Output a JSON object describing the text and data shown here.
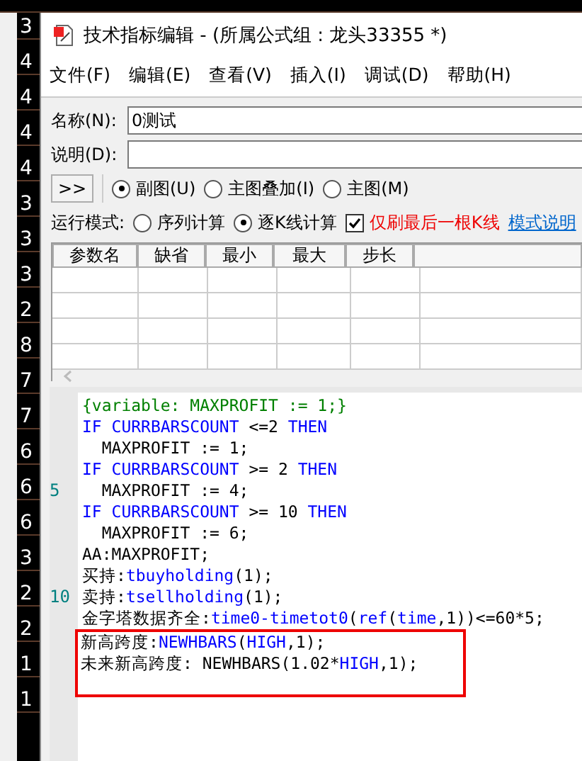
{
  "background": {
    "side_values": [
      "3",
      "4",
      "4",
      "4",
      "4",
      "3",
      "3",
      "3",
      "2",
      "8",
      "7",
      "7",
      "6",
      "6",
      "6",
      "3",
      "2",
      "2",
      "1",
      "1"
    ]
  },
  "window": {
    "title": "技术指标编辑 - (所属公式组 : 龙头33355 *)"
  },
  "menu": [
    "文件(F)",
    "编辑(E)",
    "查看(V)",
    "插入(I)",
    "调试(D)",
    "帮助(H)"
  ],
  "name_field": {
    "label": "名称(N):",
    "value": "0测试"
  },
  "description_field": {
    "label": "说明(D):"
  },
  "expand_button": ">>",
  "chart_type": [
    {
      "label": "副图(U)",
      "selected": true
    },
    {
      "label": "主图叠加(I)",
      "selected": false
    },
    {
      "label": "主图(M)",
      "selected": false
    }
  ],
  "run_mode": {
    "label": "运行模式:",
    "options": [
      {
        "label": "序列计算",
        "selected": false
      },
      {
        "label": "逐K线计算",
        "selected": true
      }
    ],
    "refresh_last": {
      "label": "仅刷最后一根K线",
      "checked": true
    },
    "help_link": "模式说明"
  },
  "params_table": {
    "columns": [
      "参数名",
      "缺省",
      "最小",
      "最大",
      "步长"
    ]
  },
  "code": {
    "lines": [
      {
        "segments": [
          {
            "kind": "comment",
            "text": "{variable: MAXPROFIT := 1;}"
          }
        ]
      },
      {
        "segments": [
          {
            "kind": "keyword",
            "text": "IF CURRBARSCOUNT"
          },
          {
            "kind": "plain",
            "text": " <=2 "
          },
          {
            "kind": "keyword",
            "text": "THEN"
          }
        ]
      },
      {
        "segments": [
          {
            "kind": "plain",
            "text": "  MAXPROFIT := 1;"
          }
        ]
      },
      {
        "segments": [
          {
            "kind": "keyword",
            "text": "IF CURRBARSCOUNT"
          },
          {
            "kind": "plain",
            "text": " >= 2 "
          },
          {
            "kind": "keyword",
            "text": "THEN"
          }
        ]
      },
      {
        "line_number": "5",
        "segments": [
          {
            "kind": "plain",
            "text": "  MAXPROFIT := 4;"
          }
        ]
      },
      {
        "segments": [
          {
            "kind": "keyword",
            "text": "IF CURRBARSCOUNT"
          },
          {
            "kind": "plain",
            "text": " >= 10 "
          },
          {
            "kind": "keyword",
            "text": "THEN"
          }
        ]
      },
      {
        "segments": [
          {
            "kind": "plain",
            "text": "  MAXPROFIT := 6;"
          }
        ]
      },
      {
        "segments": [
          {
            "kind": "plain",
            "text": "AA:MAXPROFIT;"
          }
        ]
      },
      {
        "segments": [
          {
            "kind": "plain",
            "text": "买持:"
          },
          {
            "kind": "keyword",
            "text": "tbuyholding"
          },
          {
            "kind": "plain",
            "text": "(1);"
          }
        ]
      },
      {
        "line_number": "10",
        "segments": [
          {
            "kind": "plain",
            "text": "卖持:"
          },
          {
            "kind": "keyword",
            "text": "tsellholding"
          },
          {
            "kind": "plain",
            "text": "(1);"
          }
        ]
      },
      {
        "segments": [
          {
            "kind": "plain",
            "text": "金字塔数据齐全:"
          },
          {
            "kind": "keyword",
            "text": "time0-timetot0"
          },
          {
            "kind": "plain",
            "text": "("
          },
          {
            "kind": "keyword",
            "text": "ref"
          },
          {
            "kind": "plain",
            "text": "("
          },
          {
            "kind": "keyword",
            "text": "time"
          },
          {
            "kind": "plain",
            "text": ",1))<=60*5;"
          }
        ]
      }
    ],
    "highlighted_lines": [
      {
        "segments": [
          {
            "kind": "plain",
            "text": "新高跨度:"
          },
          {
            "kind": "keyword",
            "text": "NEWHBARS"
          },
          {
            "kind": "plain",
            "text": "("
          },
          {
            "kind": "keyword",
            "text": "HIGH"
          },
          {
            "kind": "plain",
            "text": ",1);"
          }
        ]
      },
      {
        "segments": [
          {
            "kind": "plain",
            "text": "未来新高跨度: NEWHBARS(1.02*"
          },
          {
            "kind": "keyword",
            "text": "HIGH"
          },
          {
            "kind": "plain",
            "text": ",1);"
          }
        ]
      }
    ]
  }
}
